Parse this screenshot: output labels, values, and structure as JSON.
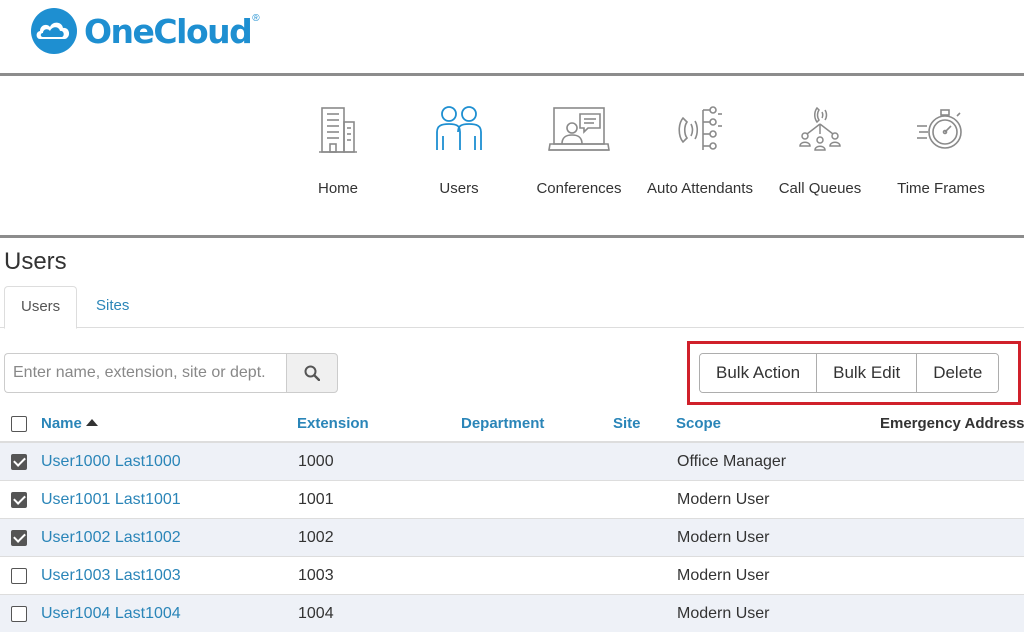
{
  "brand": {
    "name": "OneCloud",
    "registered": "®",
    "color": "#1e8fd1"
  },
  "nav": [
    {
      "label": "Home",
      "icon": "building-icon"
    },
    {
      "label": "Users",
      "icon": "users-icon",
      "active": true
    },
    {
      "label": "Conferences",
      "icon": "conference-icon"
    },
    {
      "label": "Auto Attendants",
      "icon": "auto-attendant-icon"
    },
    {
      "label": "Call Queues",
      "icon": "call-queue-icon"
    },
    {
      "label": "Time Frames",
      "icon": "stopwatch-icon"
    }
  ],
  "page": {
    "title": "Users"
  },
  "tabs": [
    {
      "label": "Users",
      "active": true
    },
    {
      "label": "Sites",
      "active": false
    }
  ],
  "search": {
    "placeholder": "Enter name, extension, site or dept.",
    "value": "",
    "icon": "search-icon"
  },
  "actions": {
    "bulk_action": "Bulk Action",
    "bulk_edit": "Bulk Edit",
    "delete": "Delete",
    "highlight_color": "#d0202a"
  },
  "table": {
    "headers": {
      "name": "Name",
      "extension": "Extension",
      "department": "Department",
      "site": "Site",
      "scope": "Scope",
      "emergency": "Emergency Address"
    },
    "sort": {
      "column": "name",
      "direction": "ascending"
    },
    "rows": [
      {
        "checked": true,
        "name": "User1000 Last1000",
        "extension": "1000",
        "department": "",
        "site": "",
        "scope": "Office Manager"
      },
      {
        "checked": true,
        "name": "User1001 Last1001",
        "extension": "1001",
        "department": "",
        "site": "",
        "scope": "Modern User"
      },
      {
        "checked": true,
        "name": "User1002 Last1002",
        "extension": "1002",
        "department": "",
        "site": "",
        "scope": "Modern User"
      },
      {
        "checked": false,
        "name": "User1003 Last1003",
        "extension": "1003",
        "department": "",
        "site": "",
        "scope": "Modern User"
      },
      {
        "checked": false,
        "name": "User1004 Last1004",
        "extension": "1004",
        "department": "",
        "site": "",
        "scope": "Modern User"
      }
    ]
  }
}
